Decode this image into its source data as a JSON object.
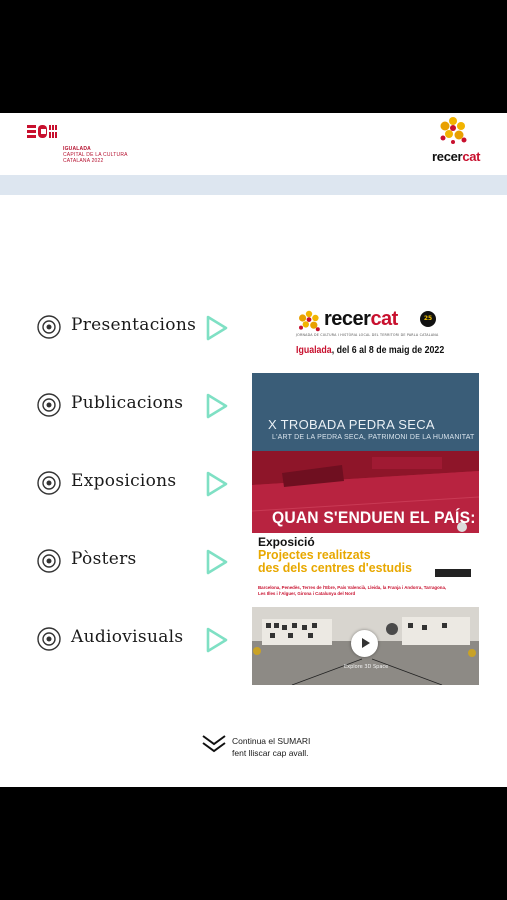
{
  "header": {
    "left_logo": {
      "name": "IGUALADA",
      "subtitle": "CAPITAL DE LA CULTURA",
      "subtitle2": "CATALANA 2022",
      "icon": "igualada-logo"
    },
    "right_logo": {
      "word_a": "recer",
      "word_b": "cat",
      "icon": "recercat-logo"
    }
  },
  "menu": {
    "items": [
      {
        "label": "Presentacions",
        "icon": "target-circle-icon",
        "arrow": "play-arrow-icon"
      },
      {
        "label": "Publicacions",
        "icon": "target-circle-icon",
        "arrow": "play-arrow-icon"
      },
      {
        "label": "Exposicions",
        "icon": "target-circle-icon",
        "arrow": "play-arrow-icon"
      },
      {
        "label": "Pòsters",
        "icon": "target-circle-icon",
        "arrow": "play-arrow-icon"
      },
      {
        "label": "Audiovisuals",
        "icon": "target-circle-icon",
        "arrow": "play-arrow-icon"
      }
    ]
  },
  "recercat": {
    "word_a": "recer",
    "word_b": "cat",
    "badge": "25",
    "tagline": "JORNADA DE CULTURA I HISTÒRIA LOCAL DEL TERRITORI DE PARLA CATALANA",
    "city": "Igualada",
    "dates": ", del 6 al 8 de maig de 2022"
  },
  "panels": {
    "trobada_title": "X TROBADA PEDRA SECA",
    "trobada_sub": "L'ART DE LA PEDRA SECA, PATRIMONI DE LA HUMANITAT",
    "pais_title": "QUAN S'ENDUEN EL PAÍS:",
    "exposicio": "Exposició",
    "projectes_line1": "Projectes realitzats",
    "projectes_line2": "des dels centres d'estudis",
    "places_line1": "Barcelona, Penedès, Terres de l'Ebre, País Valencià, Lleida, la Franja i Andorra, Tarragona,",
    "places_line2": "Les Illes i l'Alguer, Girona i Catalunya del Nord",
    "explore": "Explore 3D Space"
  },
  "footer": {
    "line1": "Continua el SUMARI",
    "line2": "fent lliscar cap avall.",
    "icon": "double-chevron-down-icon"
  },
  "colors": {
    "brand_red": "#c8102e",
    "accent_teal": "#7fe0c4",
    "band": "#dde6f0",
    "trobada_bg": "#3a5d78",
    "pais_bg": "#b21f3a",
    "projectes_yellow": "#e8a800"
  }
}
